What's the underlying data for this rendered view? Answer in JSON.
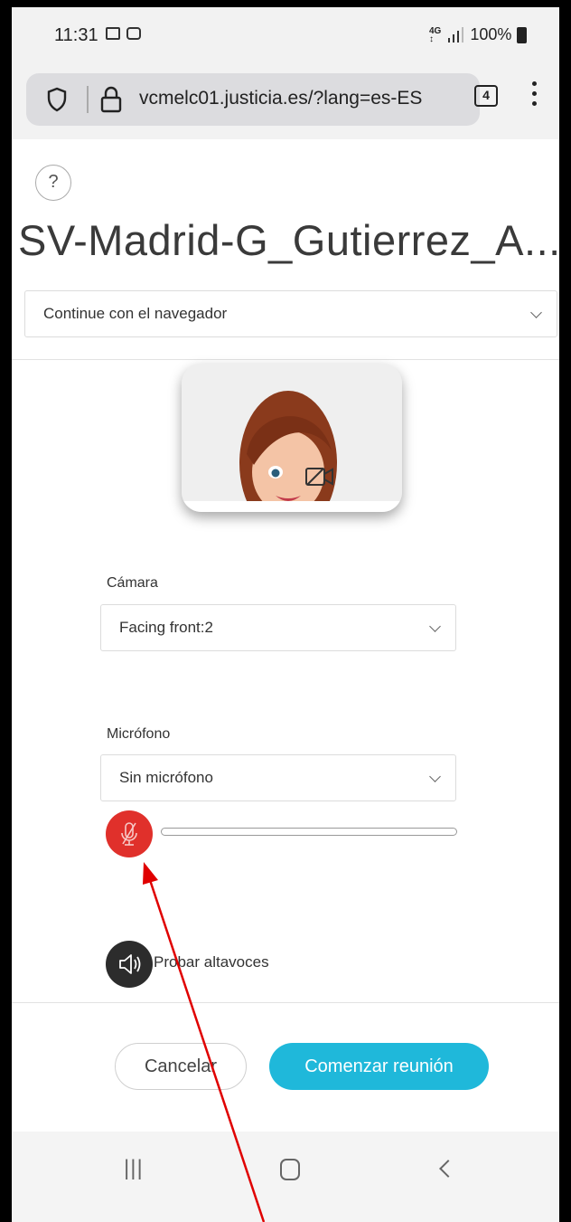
{
  "status_bar": {
    "time": "11:31",
    "network_top": "4G",
    "network_bottom": "↕",
    "battery": "100%"
  },
  "browser": {
    "url": "vcmelc01.justicia.es/?lang=es-ES",
    "tab_count": "4"
  },
  "page": {
    "help_icon": "?",
    "meeting_title": "SV-Madrid-G_Gutierrez_A...",
    "join_mode_select": "Continue con el navegador",
    "camera_label": "Cámara",
    "camera_value": "Facing front:2",
    "mic_label": "Micrófono",
    "mic_value": "Sin micrófono",
    "mic_level": 0,
    "speaker_test_label": "Probar altavoces",
    "cancel_label": "Cancelar",
    "start_label": "Comenzar reunión"
  },
  "nav": {
    "recent_icon": "|||"
  },
  "colors": {
    "mic_muted": "#e0302b",
    "primary": "#1fb8da",
    "annotation_arrow": "#e00000"
  },
  "icons": [
    "shield-icon",
    "lock-icon",
    "help-icon",
    "camera-off-icon",
    "mic-off-icon",
    "speaker-icon",
    "chevron-down-icon",
    "back-icon",
    "home-icon"
  ]
}
